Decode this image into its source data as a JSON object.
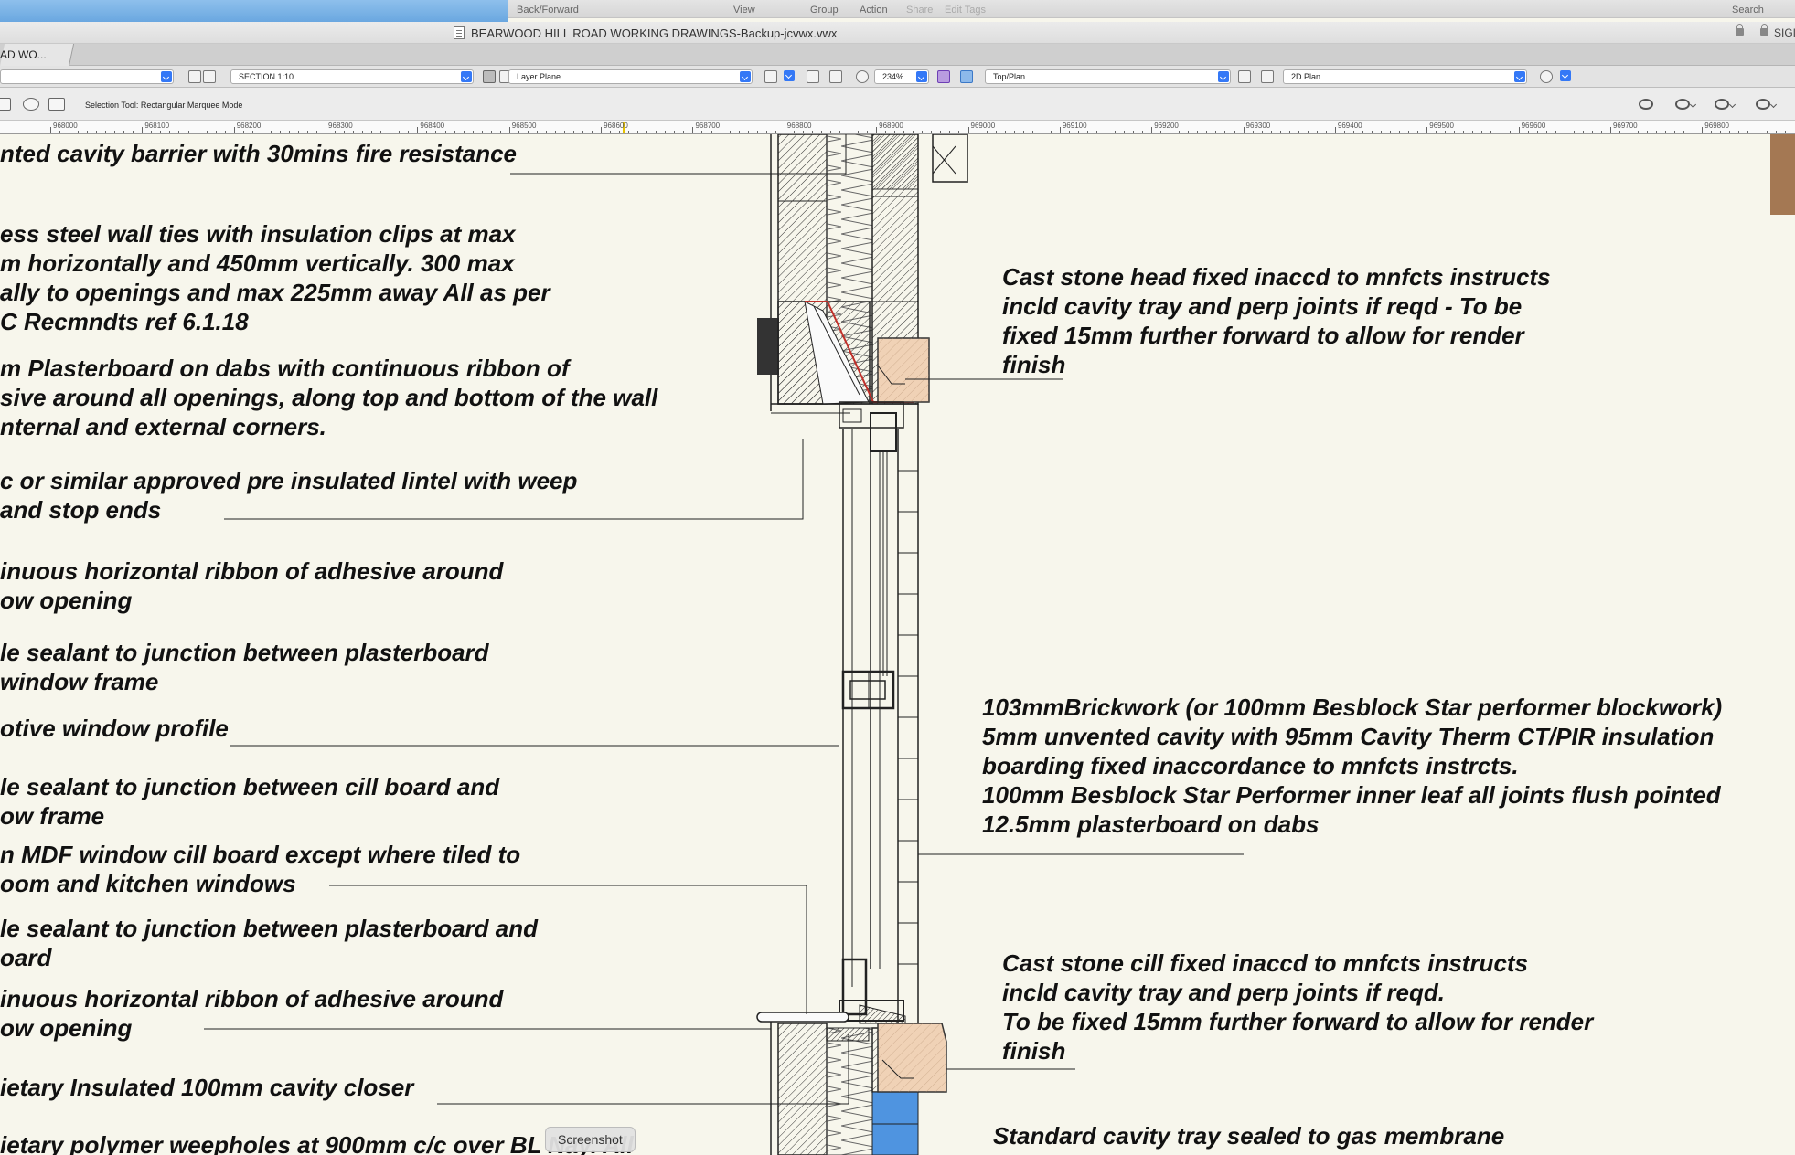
{
  "toolbar": {
    "back_forward": "Back/Forward",
    "view": "View",
    "group": "Group",
    "action": "Action",
    "share": "Share",
    "edit_tags": "Edit Tags",
    "search": "Search"
  },
  "window": {
    "title": "BEARWOOD HILL ROAD WORKING DRAWINGS-Backup-jcvwx.vwx",
    "sign_label": "SIGI",
    "tab_label": "AD WO..."
  },
  "view_bar": {
    "sheet_layer": "SECTION 1:10",
    "plane": "Layer Plane",
    "zoom": "234%",
    "view": "Top/Plan",
    "render_mode": "2D Plan"
  },
  "mode_bar": {
    "tool_label": "Selection Tool: Rectangular Marquee Mode"
  },
  "ruler": {
    "labels": [
      "968000",
      "968100",
      "968200",
      "968300",
      "968400",
      "968500",
      "968600",
      "968700",
      "968800",
      "968900",
      "969000",
      "969100",
      "969200",
      "969300",
      "969400",
      "969500",
      "969600",
      "969700",
      "969800"
    ]
  },
  "annotations": {
    "left": [
      [
        "nted cavity barrier with 30mins fire resistance"
      ],
      [
        "ess steel wall ties with insulation clips at max",
        "m horizontally and 450mm vertically. 300 max",
        "ally to openings and max 225mm away All as per",
        "C Recmndts ref 6.1.18"
      ],
      [
        "m Plasterboard on dabs with continuous ribbon of",
        "sive around all openings, along top and bottom of the wall",
        "nternal and external corners."
      ],
      [
        "c or similar approved pre insulated lintel with weep",
        " and stop ends"
      ],
      [
        "inuous horizontal ribbon of adhesive around",
        "ow opening"
      ],
      [
        "le sealant to junction between plasterboard",
        "window frame"
      ],
      [
        "otive window profile"
      ],
      [
        "le sealant to junction between cill board and",
        "ow frame"
      ],
      [
        "n MDF window cill board except where tiled to",
        "oom and kitchen windows"
      ],
      [
        "le sealant to junction between plasterboard and",
        "oard"
      ],
      [
        "inuous horizontal ribbon of adhesive around",
        "ow opening"
      ],
      [
        "ietary Insulated 100mm cavity closer"
      ],
      [
        "ietary polymer weepholes at 900mm c/c over BL  Nay. All"
      ]
    ],
    "right": [
      [
        "Cast stone head fixed inaccd to mnfcts instructs",
        "incld cavity tray and perp joints if reqd - To be",
        "fixed 15mm further forward to allow for render",
        "finish"
      ],
      [
        "103mmBrickwork (or 100mm Besblock Star performer blockwork)",
        "5mm unvented cavity with 95mm Cavity Therm CT/PIR insulation",
        "boarding fixed inaccordance to mnfcts instrcts.",
        "100mm Besblock Star Performer inner leaf all joints flush pointed",
        "12.5mm plasterboard on dabs"
      ],
      [
        "Cast stone cill fixed inaccd to mnfcts instructs",
        "incld cavity tray and perp joints if reqd.",
        "To be fixed 15mm further forward to allow for render",
        "finish"
      ],
      [
        "Standard cavity tray sealed to gas membrane"
      ]
    ]
  },
  "tooltip": {
    "label": "Screenshot"
  },
  "colors": {
    "canvas": "#f7f6ec",
    "stone": "#f0d2b6",
    "accent_blue": "#3478f6",
    "dpc_red": "#c0302a",
    "cavity_closer_blue": "#4f94e0"
  }
}
